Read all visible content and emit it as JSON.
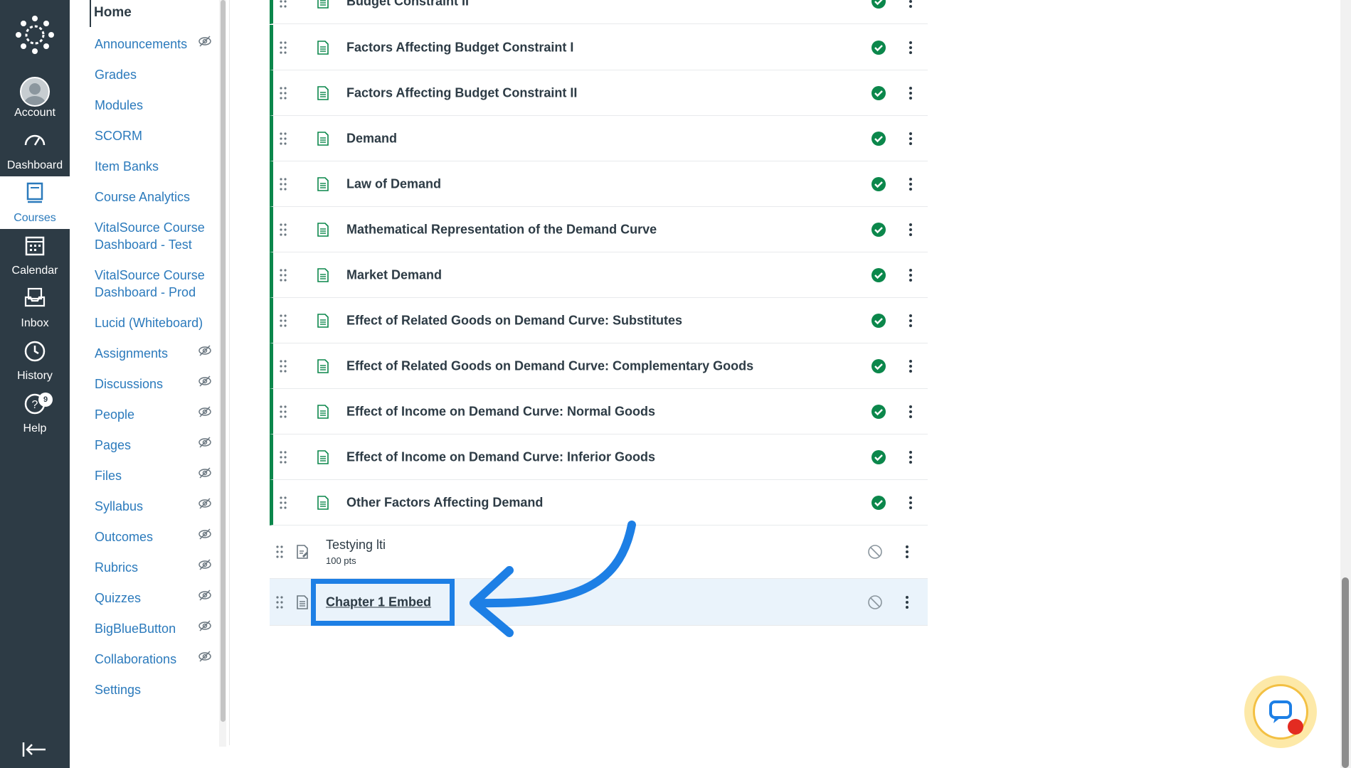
{
  "global_nav": {
    "items": [
      {
        "label": "Account",
        "icon": "avatar-icon"
      },
      {
        "label": "Dashboard",
        "icon": "dashboard-icon"
      },
      {
        "label": "Courses",
        "icon": "courses-icon"
      },
      {
        "label": "Calendar",
        "icon": "calendar-icon"
      },
      {
        "label": "Inbox",
        "icon": "inbox-icon"
      },
      {
        "label": "History",
        "icon": "history-icon"
      },
      {
        "label": "Help",
        "icon": "help-icon"
      }
    ],
    "help_badge": "9",
    "colors": {
      "background": "#2d3b45",
      "active_text": "#2b7abc"
    }
  },
  "course_nav": {
    "home": "Home",
    "items": [
      {
        "label": "Announcements",
        "hidden": true
      },
      {
        "label": "Grades",
        "hidden": false
      },
      {
        "label": "Modules",
        "hidden": false
      },
      {
        "label": "SCORM",
        "hidden": false
      },
      {
        "label": "Item Banks",
        "hidden": false
      },
      {
        "label": "Course Analytics",
        "hidden": false
      },
      {
        "label": "VitalSource Course Dashboard - Test",
        "hidden": false
      },
      {
        "label": "VitalSource Course Dashboard - Prod",
        "hidden": false
      },
      {
        "label": "Lucid (Whiteboard)",
        "hidden": false
      },
      {
        "label": "Assignments",
        "hidden": true
      },
      {
        "label": "Discussions",
        "hidden": true
      },
      {
        "label": "People",
        "hidden": true
      },
      {
        "label": "Pages",
        "hidden": true
      },
      {
        "label": "Files",
        "hidden": true
      },
      {
        "label": "Syllabus",
        "hidden": true
      },
      {
        "label": "Outcomes",
        "hidden": true
      },
      {
        "label": "Rubrics",
        "hidden": true
      },
      {
        "label": "Quizzes",
        "hidden": true
      },
      {
        "label": "BigBlueButton",
        "hidden": true
      },
      {
        "label": "Collaborations",
        "hidden": true
      },
      {
        "label": "Settings",
        "hidden": false
      }
    ]
  },
  "module": {
    "items": [
      {
        "title": "Budget Constraint II",
        "published": true
      },
      {
        "title": "Factors Affecting Budget Constraint I",
        "published": true
      },
      {
        "title": "Factors Affecting Budget Constraint II",
        "published": true
      },
      {
        "title": "Demand",
        "published": true
      },
      {
        "title": "Law of Demand",
        "published": true
      },
      {
        "title": "Mathematical Representation of the Demand Curve",
        "published": true
      },
      {
        "title": "Market Demand",
        "published": true
      },
      {
        "title": "Effect of Related Goods on Demand Curve: Substitutes",
        "published": true
      },
      {
        "title": "Effect of Related Goods on Demand Curve: Complementary Goods",
        "published": true
      },
      {
        "title": "Effect of Income on Demand Curve: Normal Goods",
        "published": true
      },
      {
        "title": "Effect of Income on Demand Curve: Inferior Goods",
        "published": true
      },
      {
        "title": "Other Factors Affecting Demand",
        "published": true
      }
    ],
    "assignment": {
      "title": "Testying lti",
      "points": "100 pts",
      "published": false
    },
    "embed": {
      "title": "Chapter 1 Embed",
      "published": false
    },
    "colors": {
      "published": "#0b874b",
      "indent_border": "#0b874b",
      "callout": "#1d7fe5"
    }
  }
}
